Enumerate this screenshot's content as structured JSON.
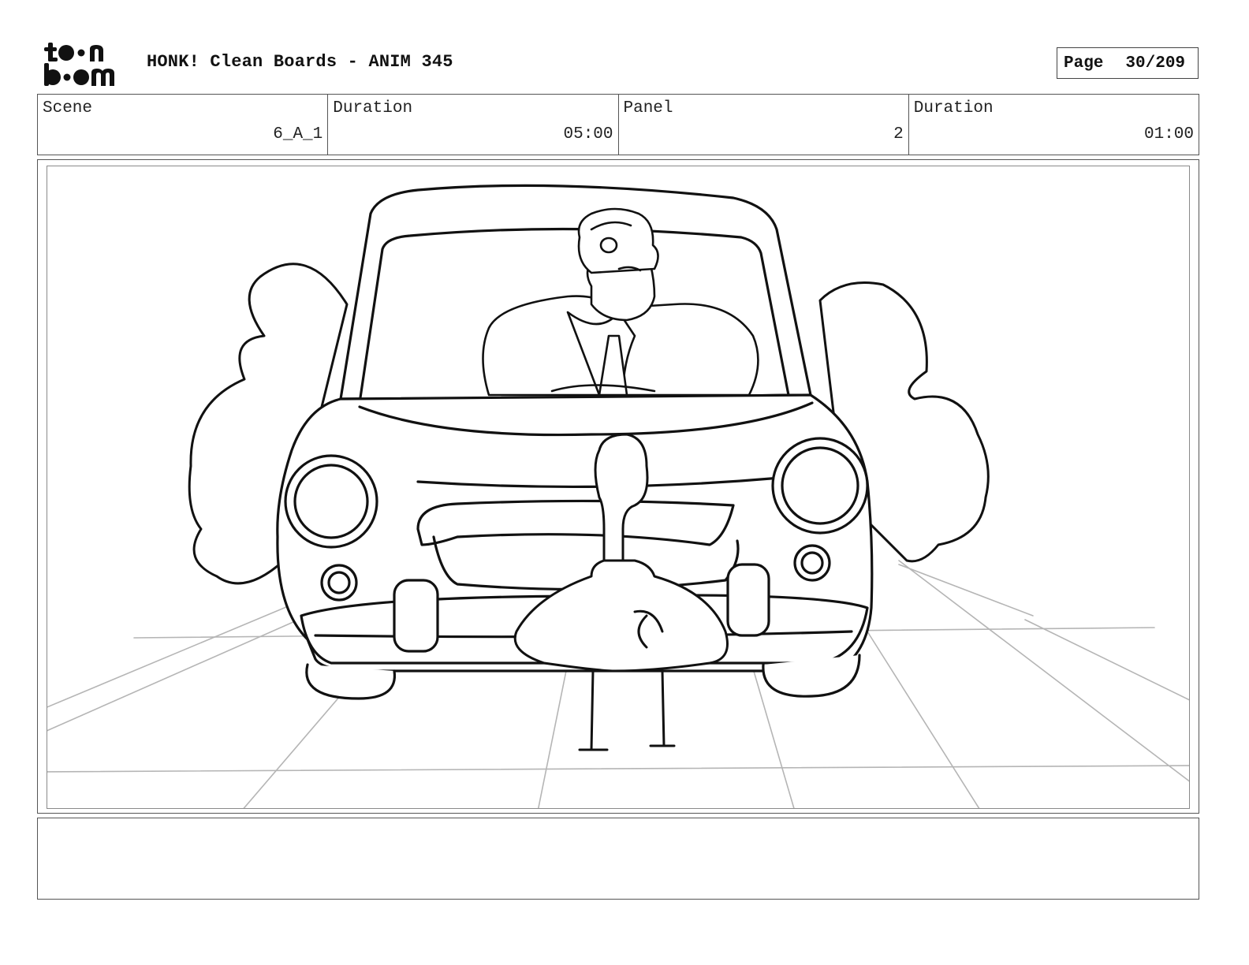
{
  "logo": {
    "text": "toon boom",
    "icon": "toon-boom-logo"
  },
  "header": {
    "title": "HONK! Clean Boards - ANIM 345",
    "page_label": "Page",
    "page_number": "30/209"
  },
  "info": {
    "scene_label": "Scene",
    "scene_value": "6_A_1",
    "scene_duration_label": "Duration",
    "scene_duration_value": "05:00",
    "panel_label": "Panel",
    "panel_value": "2",
    "panel_duration_label": "Duration",
    "panel_duration_value": "01:00"
  },
  "panel": {
    "image_icon": "storyboard-drawing-car-goose",
    "line_color": "#111111",
    "floor_color": "#b5b5b5"
  },
  "notes": {
    "text": ""
  }
}
